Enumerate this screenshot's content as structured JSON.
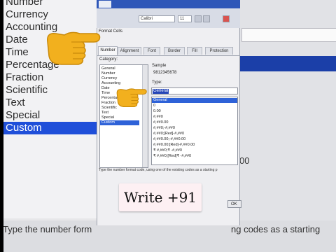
{
  "background": {
    "category_items": [
      "Number",
      "Currency",
      "Accounting",
      "Date",
      "Time",
      "Percentage",
      "Fraction",
      "Scientific",
      "Text",
      "Special",
      "Custom"
    ],
    "selected_category": "Custom",
    "bottom_text_left": "Type the number form",
    "bottom_text_right": "ng codes as a starting",
    "side_value": "00"
  },
  "ribbon": {
    "font": "Calibri",
    "size": "11"
  },
  "dialog": {
    "title": "Format Cells",
    "tabs": [
      "Number",
      "Alignment",
      "Font",
      "Border",
      "Fill",
      "Protection"
    ],
    "active_tab": "Number",
    "category_label": "Category:",
    "categories": [
      "General",
      "Number",
      "Currency",
      "Accounting",
      "Date",
      "Time",
      "Percentage",
      "Fraction",
      "Scientific",
      "Text",
      "Special",
      "Custom"
    ],
    "selected_category": "Custom",
    "sample_label": "Sample",
    "sample_value": "9812345678",
    "type_label": "Type:",
    "type_value": "General",
    "formats": [
      "General",
      "0",
      "0.00",
      "#,##0",
      "#,##0.00",
      "#,##0;-#,##0",
      "#,##0;[Red]-#,##0",
      "#,##0.00;-#,##0.00",
      "#,##0.00;[Red]-#,##0.00",
      "₹ #,##0;₹ -#,##0",
      "₹ #,##0;[Red]₹ -#,##0"
    ],
    "selected_format": "General",
    "hint": "Type the number format code, using one of the existing codes as a starting p",
    "ok_label": "OK"
  },
  "caption": "Write +91",
  "colors": {
    "selection": "#2e62d8",
    "caption_bg": "#fdf0f3",
    "ribbon_blue": "#2f57b8"
  },
  "icons": [
    "pointing-hand-icon"
  ]
}
